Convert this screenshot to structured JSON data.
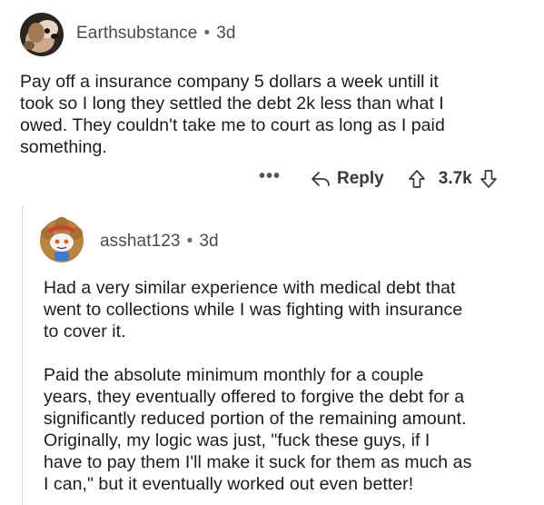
{
  "comment": {
    "author": "Earthsubstance",
    "separator": "•",
    "age": "3d",
    "text": "Pay off a insurance company 5 dollars a week untill it\ntook so I long they settled the debt 2k less than what I\nowed. They couldn't take me to court as long as I paid\nsomething.",
    "actions": {
      "more": "•••",
      "reply_label": "Reply",
      "score": "3.7k"
    }
  },
  "reply": {
    "author": "asshat123",
    "separator": "•",
    "age": "3d",
    "paragraph_1": "Had a very similar experience with medical debt that\nwent to collections while I was fighting with insurance\nto cover it.",
    "paragraph_2": "Paid the absolute minimum monthly for a couple\nyears, they eventually offered to forgive the debt for a\nsignificantly reduced portion of the remaining amount.\nOriginally, my logic was just, \"fuck these guys, if I\nhave to pay them I'll make it suck for them as much as\nI can,\" but it eventually worked out even better!"
  },
  "colors": {
    "text": "#1c1c1c",
    "meta": "#4a4a4a",
    "thread_line": "#d8d8d8"
  },
  "icons": {
    "reply": "reply-arrow-icon",
    "upvote": "upvote-arrow-icon",
    "downvote": "downvote-arrow-icon"
  }
}
